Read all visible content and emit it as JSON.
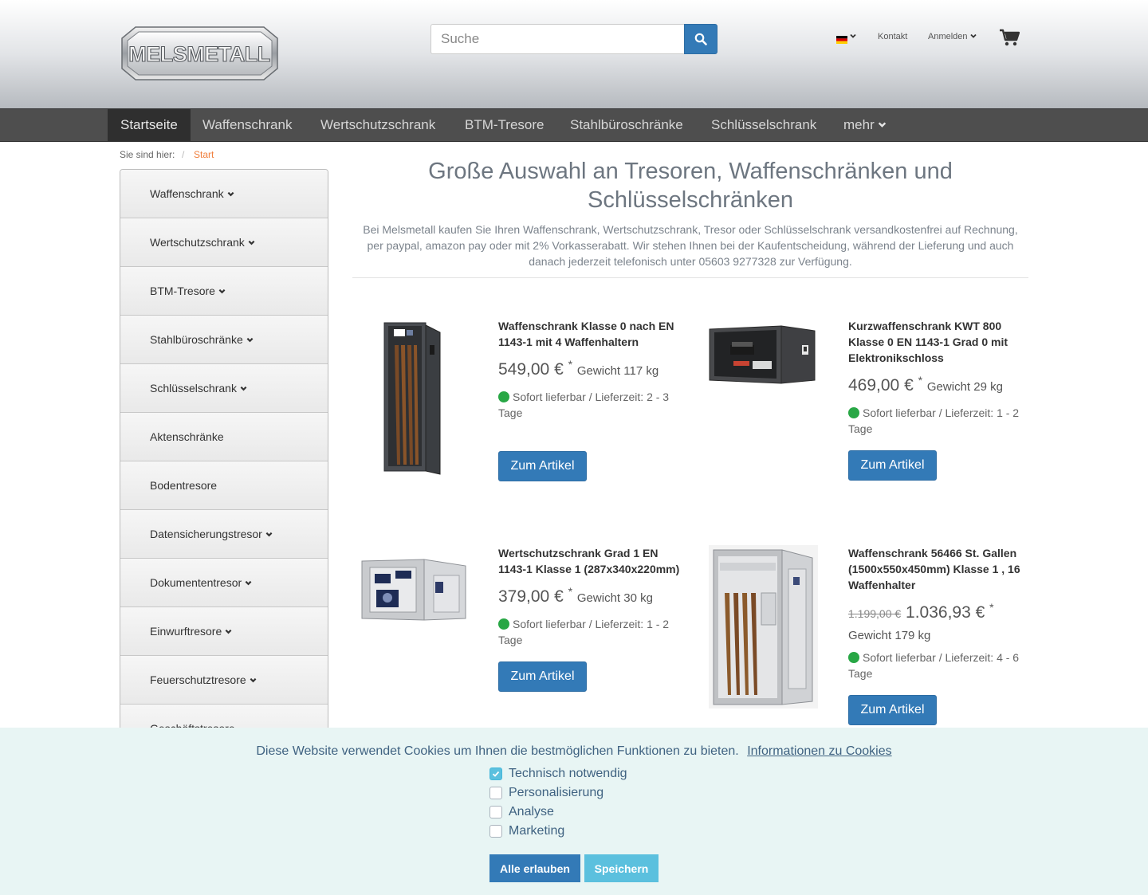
{
  "header": {
    "logo_text": "MELSMETALL",
    "search_placeholder": "Suche",
    "lang_icon": "flag-de-icon",
    "kontakt": "Kontakt",
    "anmelden": "Anmelden"
  },
  "nav": {
    "items": [
      "Startseite",
      "Waffenschrank",
      "Wertschutzschrank",
      "BTM-Tresore",
      "Stahlbüroschränke",
      "Schlüsselschrank",
      "mehr"
    ],
    "active": "Startseite"
  },
  "breadcrumb": {
    "label": "Sie sind hier:",
    "separator": "/",
    "current": "Start"
  },
  "sidebar": {
    "items": [
      "Waffenschrank",
      "Wertschutzschrank",
      "BTM-Tresore",
      "Stahlbüroschränke",
      "Schlüsselschrank",
      "Aktenschränke",
      "Bodentresore",
      "Datensicherungstresor",
      "Dokumententresor",
      "Einwurftresore",
      "Feuerschutztresore",
      "Geschäftstresore"
    ]
  },
  "main": {
    "title": "Große Auswahl an Tresoren, Waffenschränken und Schlüsselschränken",
    "intro": "Bei Melsmetall kaufen Sie Ihren Waffenschrank, Wertschutzschrank, Tresor oder Schlüsselschrank versandkostenfrei auf Rechnung, per paypal, amazon pay oder mit 2% Vorkasserabatt. Wir stehen Ihnen bei der Kaufentscheidung, während der Lieferung und auch danach jederzeit telefonisch unter 05603 9277328 zur Verfügung."
  },
  "products": [
    {
      "title": "Waffenschrank Klasse 0 nach EN 1143-1 mit 4 Waffenhaltern",
      "price": "549,00 €",
      "star": "*",
      "weight": "Gewicht 117 kg",
      "availability": "Sofort lieferbar / Lieferzeit: 2 - 3 Tage",
      "button": "Zum Artikel"
    },
    {
      "title": "Kurzwaffenschrank KWT 800 Klasse 0 EN 1143-1 Grad 0 mit Elektronikschloss",
      "price": "469,00 €",
      "star": "*",
      "weight": "Gewicht 29 kg",
      "availability": "Sofort lieferbar / Lieferzeit: 1 - 2 Tage",
      "button": "Zum Artikel"
    },
    {
      "title": "Wertschutzschrank Grad 1 EN 1143-1 Klasse 1 (287x340x220mm)",
      "price": "379,00 €",
      "star": "*",
      "weight": "Gewicht 30 kg",
      "availability": "Sofort lieferbar / Lieferzeit: 1 - 2 Tage",
      "button": "Zum Artikel"
    },
    {
      "title": "Waffenschrank 56466 St. Gallen (1500x550x450mm) Klasse 1 , 16 Waffenhalter",
      "old_price": "1.199,00 €",
      "price": "1.036,93 €",
      "star": "*",
      "weight": "Gewicht 179 kg",
      "availability": "Sofort lieferbar / Lieferzeit: 4 - 6 Tage",
      "button": "Zum Artikel"
    }
  ],
  "cookie": {
    "message": "Diese Website verwendet Cookies um Ihnen die bestmöglichen Funktionen zu bieten.",
    "link": "Informationen zu Cookies",
    "options": [
      {
        "label": "Technisch notwendig",
        "checked": true
      },
      {
        "label": "Personalisierung",
        "checked": false
      },
      {
        "label": "Analyse",
        "checked": false
      },
      {
        "label": "Marketing",
        "checked": false
      }
    ],
    "allow_all": "Alle erlauben",
    "save": "Speichern"
  },
  "colors": {
    "accent_blue": "#337ab7",
    "nav_bg": "#4e4e4e",
    "breadcrumb_current": "#f07e3c",
    "available_green": "#28a745",
    "cookie_bg": "#e8f5f4",
    "cookie_allow_btn": "#337ab7",
    "cookie_save_btn": "#5bc0de"
  }
}
